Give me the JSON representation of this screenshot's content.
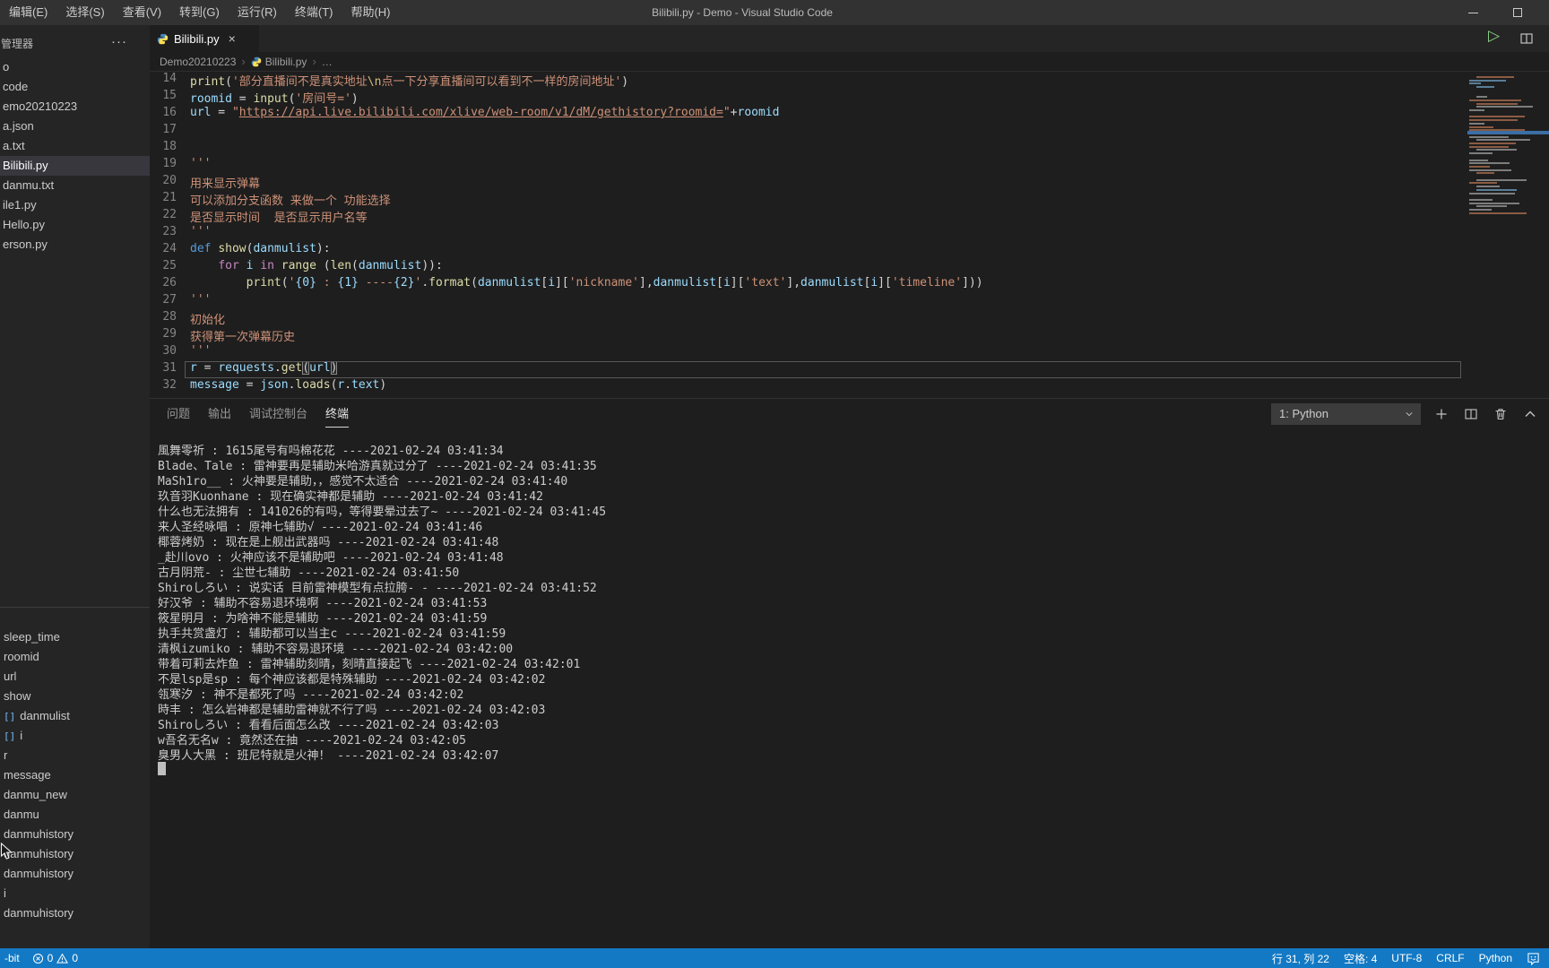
{
  "window": {
    "title": "Bilibili.py - Demo - Visual Studio Code"
  },
  "menu": {
    "items": [
      "编辑(E)",
      "选择(S)",
      "查看(V)",
      "转到(G)",
      "运行(R)",
      "终端(T)",
      "帮助(H)"
    ]
  },
  "sidebar": {
    "header": "管理器",
    "more_glyph": "···",
    "files": [
      {
        "label": "o",
        "selected": false
      },
      {
        "label": "code",
        "selected": false
      },
      {
        "label": "emo20210223",
        "selected": false
      },
      {
        "label": "a.json",
        "selected": false
      },
      {
        "label": "a.txt",
        "selected": false
      },
      {
        "label": "Bilibili.py",
        "selected": true
      },
      {
        "label": "danmu.txt",
        "selected": false
      },
      {
        "label": "ile1.py",
        "selected": false
      },
      {
        "label": "Hello.py",
        "selected": false
      },
      {
        "label": "erson.py",
        "selected": false
      }
    ],
    "outline": [
      {
        "label": "sleep_time",
        "icon": false
      },
      {
        "label": "roomid",
        "icon": false
      },
      {
        "label": "url",
        "icon": false
      },
      {
        "label": "show",
        "icon": false
      },
      {
        "label": "danmulist",
        "icon": true
      },
      {
        "label": "i",
        "icon": true
      },
      {
        "label": "r",
        "icon": false
      },
      {
        "label": "message",
        "icon": false
      },
      {
        "label": "danmu_new",
        "icon": false
      },
      {
        "label": "danmu",
        "icon": false
      },
      {
        "label": "danmuhistory",
        "icon": false
      },
      {
        "label": "danmuhistory",
        "icon": false
      },
      {
        "label": "danmuhistory",
        "icon": false
      },
      {
        "label": "i",
        "icon": false
      },
      {
        "label": "danmuhistory",
        "icon": false
      }
    ]
  },
  "editor": {
    "tab": {
      "label": "Bilibili.py",
      "close_glyph": "×"
    },
    "run_glyph": "▷",
    "breadcrumb": {
      "items": [
        "Demo20210223",
        "Bilibili.py",
        "…"
      ],
      "separator": "›"
    },
    "code": {
      "lines": [
        {
          "n": 14,
          "tokens": [
            [
              "f",
              "print"
            ],
            [
              "d",
              "("
            ],
            [
              "s",
              "'部分直播间不是真实地址"
            ],
            [
              "e",
              "\\n"
            ],
            [
              "s",
              "点一下分享直播间可以看到不一样的房间地址'"
            ],
            [
              "d",
              ")"
            ]
          ]
        },
        {
          "n": 15,
          "tokens": [
            [
              "v",
              "roomid"
            ],
            [
              "d",
              " = "
            ],
            [
              "f",
              "input"
            ],
            [
              "d",
              "("
            ],
            [
              "s",
              "'房间号='"
            ],
            [
              "d",
              ")"
            ]
          ]
        },
        {
          "n": 16,
          "tokens": [
            [
              "v",
              "url"
            ],
            [
              "d",
              " = "
            ],
            [
              "s",
              "\""
            ],
            [
              "u",
              "https://api.live.bilibili.com/xlive/web-room/v1/dM/gethistory?roomid="
            ],
            [
              "s",
              "\""
            ],
            [
              "d",
              "+"
            ],
            [
              "v",
              "roomid"
            ]
          ]
        },
        {
          "n": 17,
          "tokens": []
        },
        {
          "n": 18,
          "tokens": []
        },
        {
          "n": 19,
          "tokens": [
            [
              "s",
              "'''"
            ]
          ]
        },
        {
          "n": 20,
          "tokens": [
            [
              "s",
              "用来显示弹幕"
            ]
          ]
        },
        {
          "n": 21,
          "tokens": [
            [
              "s",
              "可以添加分支函数 来做一个 功能选择"
            ]
          ]
        },
        {
          "n": 22,
          "tokens": [
            [
              "s",
              "是否显示时间  是否显示用户名等"
            ]
          ]
        },
        {
          "n": 23,
          "tokens": [
            [
              "s",
              "'''"
            ]
          ]
        },
        {
          "n": 24,
          "tokens": [
            [
              "k",
              "def"
            ],
            [
              "d",
              " "
            ],
            [
              "f",
              "show"
            ],
            [
              "d",
              "("
            ],
            [
              "v",
              "danmulist"
            ],
            [
              "d",
              "):"
            ]
          ]
        },
        {
          "n": 25,
          "tokens": [
            [
              "d",
              "    "
            ],
            [
              "c",
              "for"
            ],
            [
              "d",
              " "
            ],
            [
              "v",
              "i"
            ],
            [
              "d",
              " "
            ],
            [
              "c",
              "in"
            ],
            [
              "d",
              " "
            ],
            [
              "f",
              "range"
            ],
            [
              "d",
              " ("
            ],
            [
              "f",
              "len"
            ],
            [
              "d",
              "("
            ],
            [
              "v",
              "danmulist"
            ],
            [
              "d",
              ")):"
            ]
          ]
        },
        {
          "n": 26,
          "tokens": [
            [
              "d",
              "        "
            ],
            [
              "f",
              "print"
            ],
            [
              "d",
              "("
            ],
            [
              "s",
              "'"
            ],
            [
              "b",
              "{0}"
            ],
            [
              "s",
              " : "
            ],
            [
              "b",
              "{1}"
            ],
            [
              "s",
              " ----"
            ],
            [
              "b",
              "{2}"
            ],
            [
              "s",
              "'"
            ],
            [
              "d",
              "."
            ],
            [
              "f",
              "format"
            ],
            [
              "d",
              "("
            ],
            [
              "v",
              "danmulist"
            ],
            [
              "d",
              "["
            ],
            [
              "v",
              "i"
            ],
            [
              "d",
              "]["
            ],
            [
              "s",
              "'nickname'"
            ],
            [
              "d",
              "],"
            ],
            [
              "v",
              "danmulist"
            ],
            [
              "d",
              "["
            ],
            [
              "v",
              "i"
            ],
            [
              "d",
              "]["
            ],
            [
              "s",
              "'text'"
            ],
            [
              "d",
              "],"
            ],
            [
              "v",
              "danmulist"
            ],
            [
              "d",
              "["
            ],
            [
              "v",
              "i"
            ],
            [
              "d",
              "]["
            ],
            [
              "s",
              "'timeline'"
            ],
            [
              "d",
              "]))"
            ]
          ]
        },
        {
          "n": 27,
          "tokens": [
            [
              "s",
              "'''"
            ]
          ]
        },
        {
          "n": 28,
          "tokens": [
            [
              "s",
              "初始化"
            ]
          ]
        },
        {
          "n": 29,
          "tokens": [
            [
              "s",
              "获得第一次弹幕历史"
            ]
          ]
        },
        {
          "n": 30,
          "tokens": [
            [
              "s",
              "'''"
            ]
          ]
        },
        {
          "n": 31,
          "tokens": [
            [
              "v",
              "r"
            ],
            [
              "d",
              " = "
            ],
            [
              "v",
              "requests"
            ],
            [
              "d",
              "."
            ],
            [
              "f",
              "get"
            ],
            [
              "x",
              "("
            ],
            [
              "v",
              "url"
            ],
            [
              "x",
              ")"
            ]
          ],
          "current": true
        },
        {
          "n": 32,
          "tokens": [
            [
              "v",
              "message"
            ],
            [
              "d",
              " = "
            ],
            [
              "v",
              "json"
            ],
            [
              "d",
              "."
            ],
            [
              "f",
              "loads"
            ],
            [
              "d",
              "("
            ],
            [
              "v",
              "r"
            ],
            [
              "d",
              "."
            ],
            [
              "v",
              "text"
            ],
            [
              "d",
              ")"
            ]
          ]
        }
      ]
    }
  },
  "panel": {
    "tabs": [
      {
        "label": "问题",
        "active": false
      },
      {
        "label": "输出",
        "active": false
      },
      {
        "label": "调试控制台",
        "active": false
      },
      {
        "label": "终端",
        "active": true
      }
    ],
    "selector_label": "1: Python",
    "terminal_lines": [
      "風舞零祈 : 1615尾号有吗棉花花 ----2021-02-24 03:41:34",
      "Blade、Tale : 雷神要再是辅助米哈游真就过分了 ----2021-02-24 03:41:35",
      "MaSh1ro__ : 火神要是辅助，，感觉不太适合 ----2021-02-24 03:41:40",
      "玖音羽Kuonhane : 现在确实神都是辅助 ----2021-02-24 03:41:42",
      "什么也无法拥有 : 141026的有吗，等得要晕过去了~ ----2021-02-24 03:41:45",
      "来人圣经咏唱 : 原神七辅助√ ----2021-02-24 03:41:46",
      "椰蓉烤奶 : 现在是上舰出武器吗 ----2021-02-24 03:41:48",
      "_赴川ovo : 火神应该不是辅助吧 ----2021-02-24 03:41:48",
      "古月阴荒- : 尘世七辅助 ----2021-02-24 03:41:50",
      "Shiroしろい : 说实话 目前雷神模型有点拉胯- - ----2021-02-24 03:41:52",
      "好汉爷 : 辅助不容易退环境啊 ----2021-02-24 03:41:53",
      "筱星明月 : 为啥神不能是辅助 ----2021-02-24 03:41:59",
      "执手共赏盏灯 : 辅助都可以当主c ----2021-02-24 03:41:59",
      "清枫izumiko : 辅助不容易退环境 ----2021-02-24 03:42:00",
      "带着可莉去炸鱼 : 雷神辅助刻晴，刻晴直接起飞 ----2021-02-24 03:42:01",
      "不是lsp是sp : 每个神应该都是特殊辅助 ----2021-02-24 03:42:02",
      "瓴寒汐 : 神不是都死了吗 ----2021-02-24 03:42:02",
      "時丰 : 怎么岩神都是辅助雷神就不行了吗 ----2021-02-24 03:42:03",
      "Shiroしろい : 看看后面怎么改 ----2021-02-24 03:42:03",
      "w吾名无名w : 竟然还在抽 ----2021-02-24 03:42:05",
      "臭男人大黑 : 班尼特就是火神！ ----2021-02-24 03:42:07"
    ]
  },
  "statusbar": {
    "remote": "-bit",
    "errors": "0",
    "warnings": "0",
    "right_items": [
      {
        "name": "cursor-position",
        "label": "行 31, 列 22"
      },
      {
        "name": "indentation",
        "label": "空格: 4"
      },
      {
        "name": "encoding",
        "label": "UTF-8"
      },
      {
        "name": "eol",
        "label": "CRLF"
      },
      {
        "name": "language-mode",
        "label": "Python"
      }
    ]
  },
  "colors": {
    "accent": "#1379c4",
    "titlebar": "#323233",
    "sidebar": "#252526",
    "editor": "#1e1e1e",
    "run_green": "#89d185"
  }
}
